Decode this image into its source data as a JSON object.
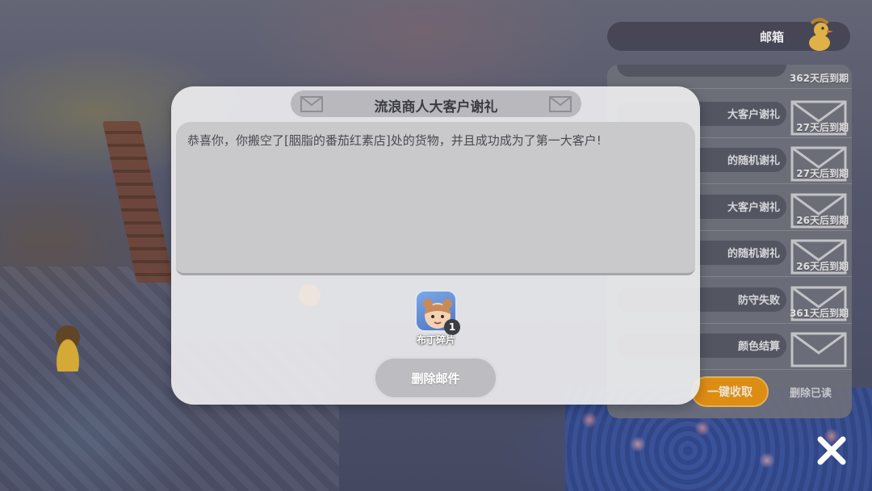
{
  "mailbox": {
    "title": "邮箱",
    "items": [
      {
        "subject": "",
        "expiry": "362天后到期"
      },
      {
        "subject": "大客户谢礼",
        "expiry": "27天后到期"
      },
      {
        "subject": "的随机谢礼",
        "expiry": "27天后到期"
      },
      {
        "subject": "大客户谢礼",
        "expiry": "26天后到期"
      },
      {
        "subject": "的随机谢礼",
        "expiry": "26天后到期"
      },
      {
        "subject": "防守失败",
        "expiry": "361天后到期"
      },
      {
        "subject": "颜色结算",
        "expiry": ""
      }
    ],
    "claim_all_label": "一键收取",
    "delete_read_label": "删除已读"
  },
  "dialog": {
    "title": "流浪商人大客户谢礼",
    "body": "恭喜你，你搬空了[胭脂的番茄红素店]处的货物，并且成功成为了第一大客户!",
    "reward": {
      "name": "布丁碎片",
      "count": "1"
    },
    "delete_label": "删除邮件"
  },
  "colors": {
    "accent_orange": "#f09a16",
    "dialog_bg": "#ececee",
    "dialog_title_bar": "#b9b9bd"
  },
  "icons": {
    "close": "close-x-icon",
    "mailbox": "duck-icon",
    "mail": "envelope-icon"
  }
}
